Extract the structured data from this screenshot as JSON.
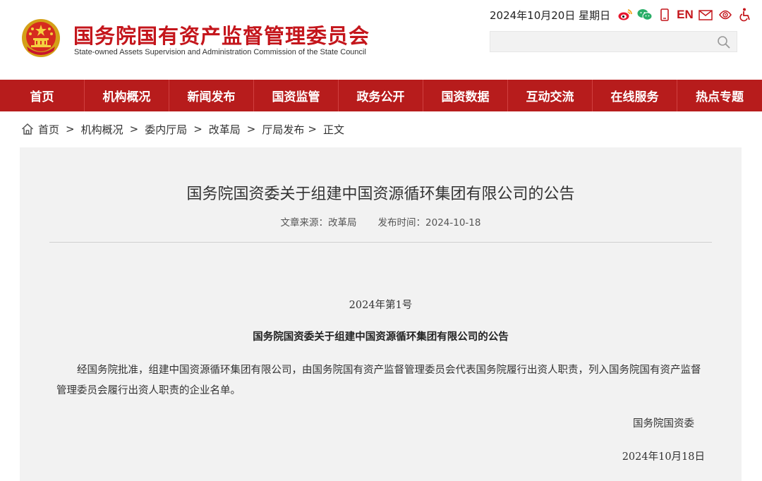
{
  "header": {
    "title": "国务院国有资产监督管理委员会",
    "subtitle": "State-owned Assets Supervision and Administration Commission of the State Council",
    "date_text": "2024年10月20日 星期日",
    "en_label": "EN",
    "icons": [
      "weibo-icon",
      "wechat-icon",
      "mobile-icon",
      "mail-icon",
      "accessibility-care-icon",
      "wheelchair-icon"
    ],
    "search_placeholder": "",
    "brand_color": "#c4161c"
  },
  "nav": {
    "items": [
      {
        "label": "首页"
      },
      {
        "label": "机构概况"
      },
      {
        "label": "新闻发布"
      },
      {
        "label": "国资监管"
      },
      {
        "label": "政务公开"
      },
      {
        "label": "国资数据"
      },
      {
        "label": "互动交流"
      },
      {
        "label": "在线服务"
      },
      {
        "label": "热点专题"
      }
    ],
    "bg_color": "#b71c1c"
  },
  "breadcrumb": {
    "items": [
      "首页",
      "机构概况",
      "委内厅局",
      "改革局",
      "厅局发布"
    ],
    "current": "正文",
    "separator": ">"
  },
  "article": {
    "title": "国务院国资委关于组建中国资源循环集团有限公司的公告",
    "source_label": "文章来源：改革局",
    "publish_label": "发布时间：2024-10-18",
    "doc_number": "2024年第1号",
    "doc_title": "国务院国资委关于组建中国资源循环集团有限公司的公告",
    "body": "经国务院批准，组建中国资源循环集团有限公司，由国务院国有资产监督管理委员会代表国务院履行出资人职责，列入国务院国有资产监督管理委员会履行出资人职责的企业名单。",
    "signature": "国务院国资委",
    "sign_date": "2024年10月18日"
  }
}
